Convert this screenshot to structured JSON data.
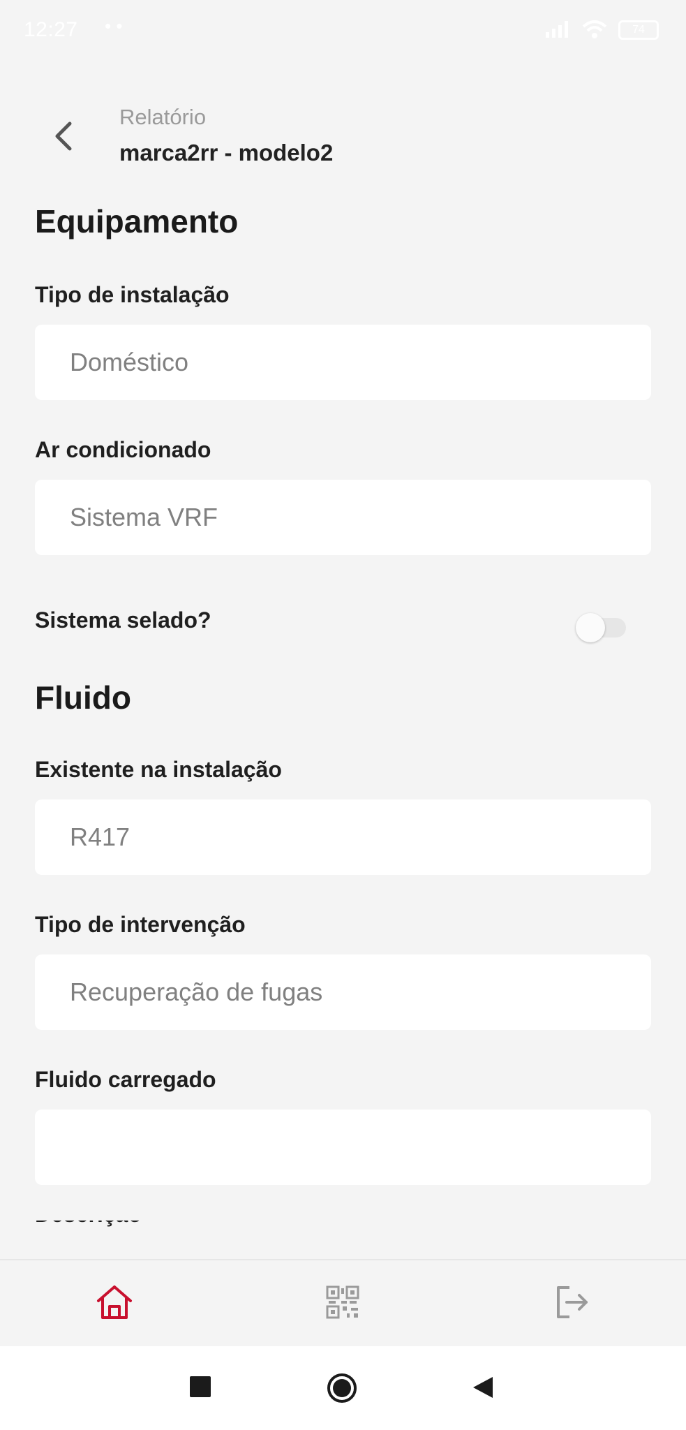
{
  "status_bar": {
    "time": "12:27",
    "dots": "• •",
    "battery": "74"
  },
  "header": {
    "subtitle": "Relatório",
    "title": "marca2rr - modelo2"
  },
  "equipment": {
    "section_title": "Equipamento",
    "installation_type_label": "Tipo de instalação",
    "installation_type_value": "Doméstico",
    "air_conditioning_label": "Ar condicionado",
    "air_conditioning_value": "Sistema VRF",
    "sealed_system_label": "Sistema selado?",
    "sealed_system_on": false
  },
  "fluid": {
    "section_title": "Fluido",
    "existing_label": "Existente na instalação",
    "existing_value": "R417",
    "intervention_label": "Tipo de intervenção",
    "intervention_value": "Recuperação de fugas",
    "charged_label": "Fluido carregado",
    "charged_value": "",
    "next_label_partial": "Descrição"
  },
  "tab_bar": {
    "items": [
      {
        "icon": "home-icon",
        "active": true
      },
      {
        "icon": "qr-code-icon",
        "active": false
      },
      {
        "icon": "logout-icon",
        "active": false
      }
    ],
    "active_color": "#c8102e",
    "inactive_color": "#9a9a9a"
  },
  "nav_bar": {
    "icons": [
      "recent-apps-icon",
      "home-circle-icon",
      "back-triangle-icon"
    ]
  }
}
